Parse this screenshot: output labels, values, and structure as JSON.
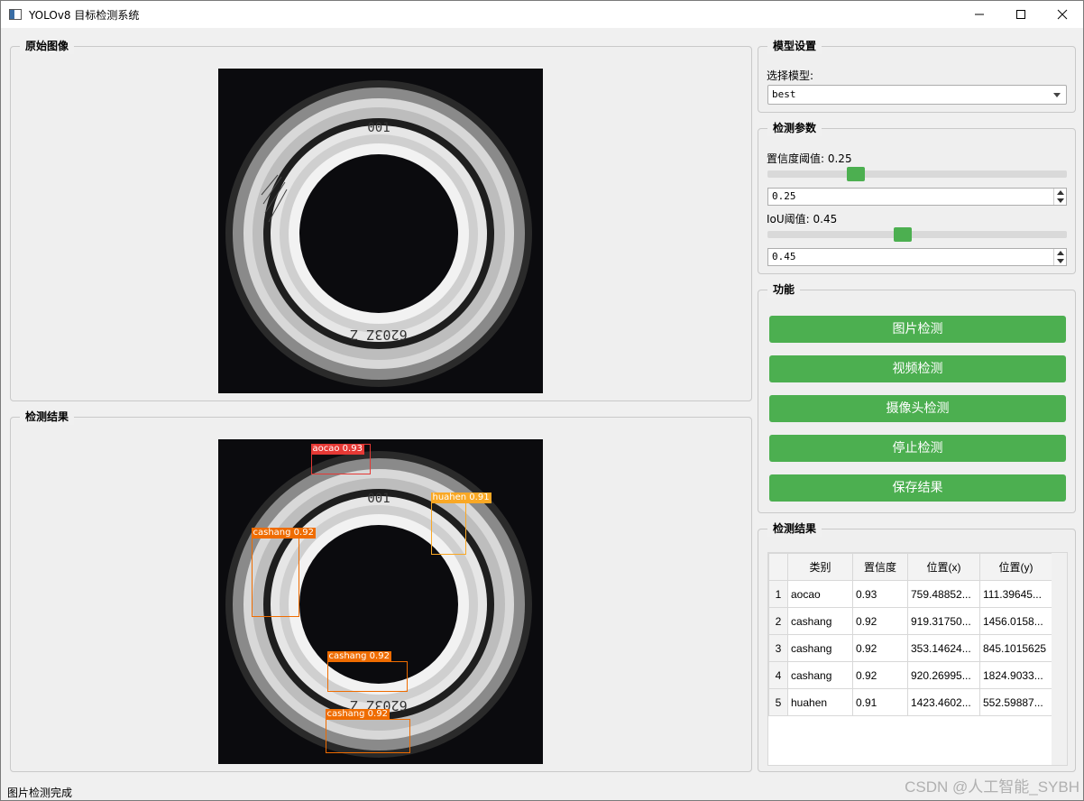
{
  "window": {
    "title": "YOLOv8 目标检测系统",
    "minimize": "—",
    "maximize": "☐",
    "close": "✕"
  },
  "left": {
    "original_title": "原始图像",
    "result_title": "检测结果"
  },
  "detections_overlay": [
    {
      "label": "aocao  0.93",
      "color": "#e53935"
    },
    {
      "label": "huahen  0.91",
      "color": "#f9a825"
    },
    {
      "label": "cashang  0.92",
      "color": "#ef6c00"
    },
    {
      "label": "cashang  0.92",
      "color": "#ef6c00"
    },
    {
      "label": "cashang  0.92",
      "color": "#ef6c00"
    }
  ],
  "model_settings": {
    "title": "模型设置",
    "select_label": "选择模型:",
    "selected_model": "best"
  },
  "params": {
    "title": "检测参数",
    "conf_label": "置信度阈值: 0.25",
    "conf_value": "0.25",
    "conf_level": 0.25,
    "iou_label": "IoU阈值: 0.45",
    "iou_value": "0.45",
    "iou_level": 0.45
  },
  "functions": {
    "title": "功能",
    "image_detect": "图片检测",
    "video_detect": "视频检测",
    "camera_detect": "摄像头检测",
    "stop_detect": "停止检测",
    "save_results": "保存结果"
  },
  "results": {
    "title": "检测结果",
    "headers": [
      "类别",
      "置信度",
      "位置(x)",
      "位置(y)"
    ],
    "rows": [
      {
        "n": "1",
        "cls": "aocao",
        "conf": "0.93",
        "x": "759.48852...",
        "y": "111.39645..."
      },
      {
        "n": "2",
        "cls": "cashang",
        "conf": "0.92",
        "x": "919.31750...",
        "y": "1456.0158..."
      },
      {
        "n": "3",
        "cls": "cashang",
        "conf": "0.92",
        "x": "353.14624...",
        "y": "845.1015625"
      },
      {
        "n": "4",
        "cls": "cashang",
        "conf": "0.92",
        "x": "920.26995...",
        "y": "1824.9033..."
      },
      {
        "n": "5",
        "cls": "huahen",
        "conf": "0.91",
        "x": "1423.4602...",
        "y": "552.59887..."
      }
    ]
  },
  "status": "图片检测完成",
  "watermark": "CSDN @人工智能_SYBH",
  "colors": {
    "accent": "#4caf50"
  }
}
